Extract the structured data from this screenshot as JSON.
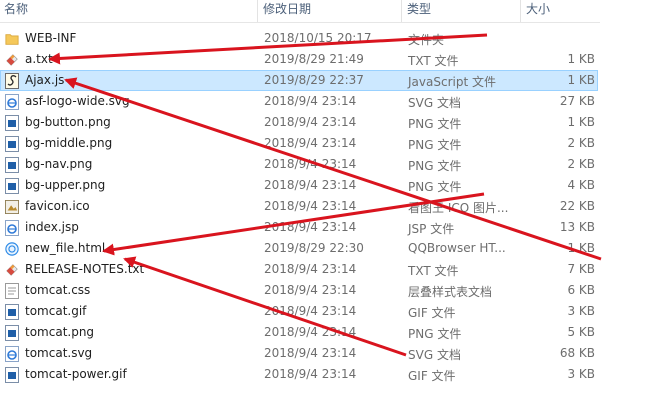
{
  "columns": {
    "name": "名称",
    "date": "修改日期",
    "type": "类型",
    "size": "大小"
  },
  "selected_index": 2,
  "files": [
    {
      "name": "WEB-INF",
      "date": "2018/10/15 20:17",
      "type": "文件夹",
      "size": "",
      "icon": "folder-icon"
    },
    {
      "name": "a.txt",
      "date": "2019/8/29 21:49",
      "type": "TXT 文件",
      "size": "1 KB",
      "icon": "txt-file-icon"
    },
    {
      "name": "Ajax.js",
      "date": "2019/8/29 22:37",
      "type": "JavaScript 文件",
      "size": "1 KB",
      "icon": "js-file-icon"
    },
    {
      "name": "asf-logo-wide.svg",
      "date": "2018/9/4 23:14",
      "type": "SVG 文档",
      "size": "27 KB",
      "icon": "ie-document-icon"
    },
    {
      "name": "bg-button.png",
      "date": "2018/9/4 23:14",
      "type": "PNG 文件",
      "size": "1 KB",
      "icon": "image-file-icon"
    },
    {
      "name": "bg-middle.png",
      "date": "2018/9/4 23:14",
      "type": "PNG 文件",
      "size": "2 KB",
      "icon": "image-file-icon"
    },
    {
      "name": "bg-nav.png",
      "date": "2018/9/4 23:14",
      "type": "PNG 文件",
      "size": "2 KB",
      "icon": "image-file-icon"
    },
    {
      "name": "bg-upper.png",
      "date": "2018/9/4 23:14",
      "type": "PNG 文件",
      "size": "4 KB",
      "icon": "image-file-icon"
    },
    {
      "name": "favicon.ico",
      "date": "2018/9/4 23:14",
      "type": "看图王 ICO 图片...",
      "size": "22 KB",
      "icon": "ico-file-icon"
    },
    {
      "name": "index.jsp",
      "date": "2018/9/4 23:14",
      "type": "JSP 文件",
      "size": "13 KB",
      "icon": "ie-document-icon"
    },
    {
      "name": "new_file.html",
      "date": "2019/8/29 22:30",
      "type": "QQBrowser HT...",
      "size": "1 KB",
      "icon": "browser-html-icon"
    },
    {
      "name": "RELEASE-NOTES.txt",
      "date": "2018/9/4 23:14",
      "type": "TXT 文件",
      "size": "7 KB",
      "icon": "txt-file-icon"
    },
    {
      "name": "tomcat.css",
      "date": "2018/9/4 23:14",
      "type": "层叠样式表文档",
      "size": "6 KB",
      "icon": "css-file-icon"
    },
    {
      "name": "tomcat.gif",
      "date": "2018/9/4 23:14",
      "type": "GIF 文件",
      "size": "3 KB",
      "icon": "image-file-icon"
    },
    {
      "name": "tomcat.png",
      "date": "2018/9/4 23:14",
      "type": "PNG 文件",
      "size": "5 KB",
      "icon": "image-file-icon"
    },
    {
      "name": "tomcat.svg",
      "date": "2018/9/4 23:14",
      "type": "SVG 文档",
      "size": "68 KB",
      "icon": "ie-document-icon"
    },
    {
      "name": "tomcat-power.gif",
      "date": "2018/9/4 23:14",
      "type": "GIF 文件",
      "size": "3 KB",
      "icon": "image-file-icon"
    }
  ],
  "annotation_color": "#d9141e",
  "colors": {
    "selection_bg": "#cce8ff",
    "selection_border": "#99d1ff",
    "header_text": "#4c607a"
  }
}
